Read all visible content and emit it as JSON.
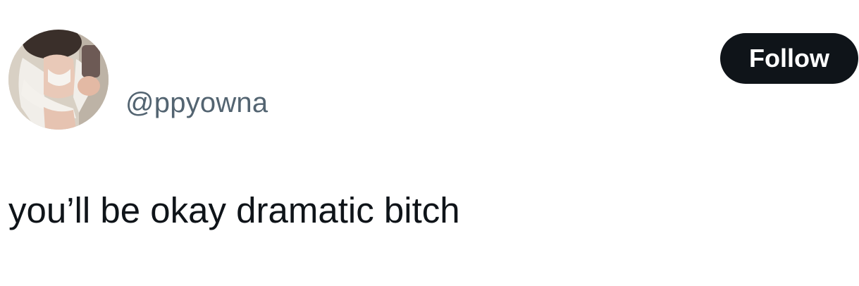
{
  "profile": {
    "handle": "@ppyowna",
    "avatar_icon": "profile-photo"
  },
  "actions": {
    "follow_label": "Follow"
  },
  "tweet": {
    "text": "you’ll be okay dramatic bitch"
  },
  "colors": {
    "text_primary": "#0f1419",
    "text_secondary": "#536471",
    "button_bg": "#0f1419",
    "button_text": "#ffffff",
    "background": "#ffffff"
  }
}
